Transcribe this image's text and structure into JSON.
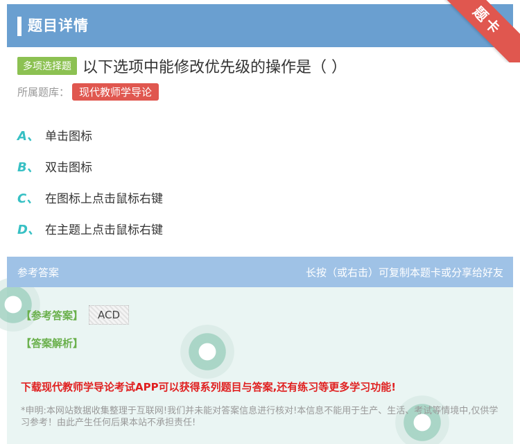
{
  "header": {
    "title": "题目详情",
    "ribbon": "题卡"
  },
  "question": {
    "type_badge": "多项选择题",
    "text": "以下选项中能修改优先级的操作是（ ）",
    "bank_label": "所属题库：",
    "bank_name": "现代教师学导论"
  },
  "options": [
    {
      "letter": "A、",
      "text": "单击图标"
    },
    {
      "letter": "B、",
      "text": "双击图标"
    },
    {
      "letter": "C、",
      "text": "在图标上点击鼠标右键"
    },
    {
      "letter": "D、",
      "text": "在主题上点击鼠标右键"
    }
  ],
  "answer": {
    "head_left": "参考答案",
    "head_right": "长按（或右击）可复制本题卡或分享给好友",
    "ref_label": "【参考答案】",
    "ref_value": "ACD",
    "analysis_label": "【答案解析】",
    "promo": "下载现代教师学导论考试APP可以获得系列题目与答案,还有练习等更多学习功能!",
    "disclaimer": "*申明:本网站数据收集整理于互联网!我们并未能对答案信息进行核对!本信息不能用于生产、生活、考试等情境中,仅供学习参考！由此产生任何后果本站不承担责任!"
  },
  "colors": {
    "header": "#6a9fd0",
    "ribbon": "#e0574f",
    "type_badge": "#8cc152",
    "option_letter": "#37c0c4",
    "answer_label": "#6ab04c",
    "promo": "#e02020"
  }
}
